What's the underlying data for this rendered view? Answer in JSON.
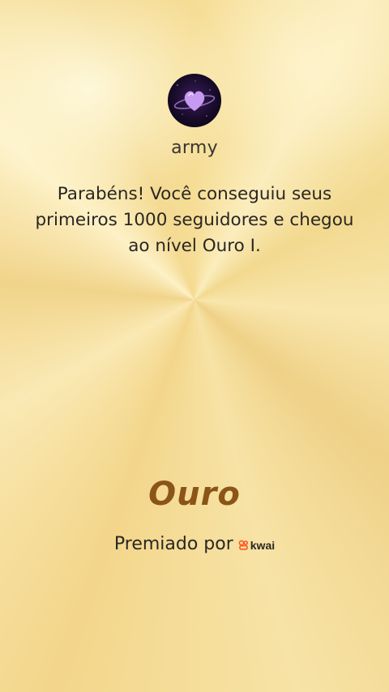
{
  "profile": {
    "username": "army",
    "avatar_icon": "purple-heart-planet-icon"
  },
  "message": "Parabéns! Você conseguiu seus primeiros 1000 seguidores e chegou ao nível Ouro I.",
  "level": {
    "name": "Ouro",
    "color": "#8a5516"
  },
  "award": {
    "label": "Premiado por",
    "brand": "kwai",
    "brand_color": "#ff5722"
  }
}
